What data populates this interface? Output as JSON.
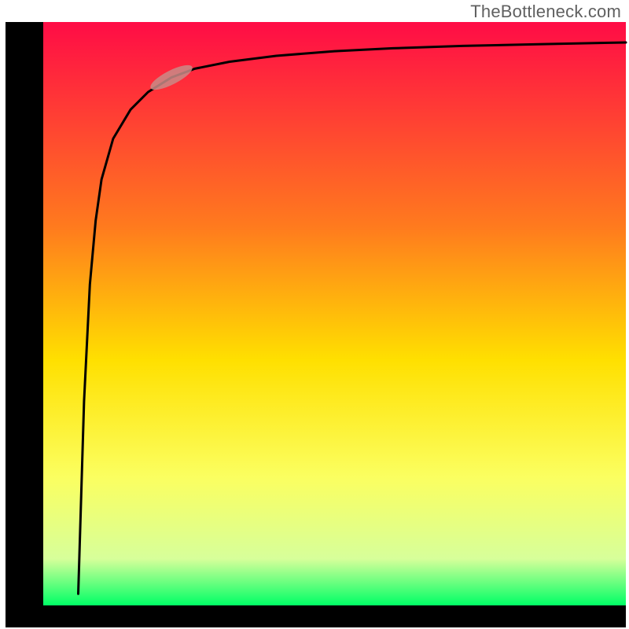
{
  "attribution": "TheBottleneck.com",
  "colors": {
    "axis": "#000000",
    "curve": "#000000",
    "marker_fill": "#c98b87",
    "marker_stroke": "#c98b87",
    "grad_top": "#ff0c46",
    "grad_mid_upper": "#ff7a1e",
    "grad_mid": "#ffe000",
    "grad_mid_lower": "#fbff60",
    "grad_lower": "#d7ff9a",
    "grad_bottom": "#00ff66"
  },
  "chart_data": {
    "type": "line",
    "title": "",
    "xlabel": "",
    "ylabel": "",
    "xlim": [
      0,
      100
    ],
    "ylim": [
      0,
      100
    ],
    "legend": null,
    "annotations": [],
    "series": [
      {
        "name": "curve",
        "x": [
          6,
          7,
          8,
          9,
          10,
          12,
          15,
          18,
          22,
          26,
          32,
          40,
          50,
          60,
          72,
          85,
          100
        ],
        "values": [
          2,
          35,
          55,
          66,
          73,
          80,
          85,
          88,
          90.5,
          92,
          93.2,
          94.2,
          95,
          95.5,
          95.9,
          96.2,
          96.5
        ]
      }
    ],
    "marker": {
      "x": 22,
      "y": 90.5,
      "rx": 4.0,
      "ry": 1.2,
      "angle_deg": -27
    }
  }
}
